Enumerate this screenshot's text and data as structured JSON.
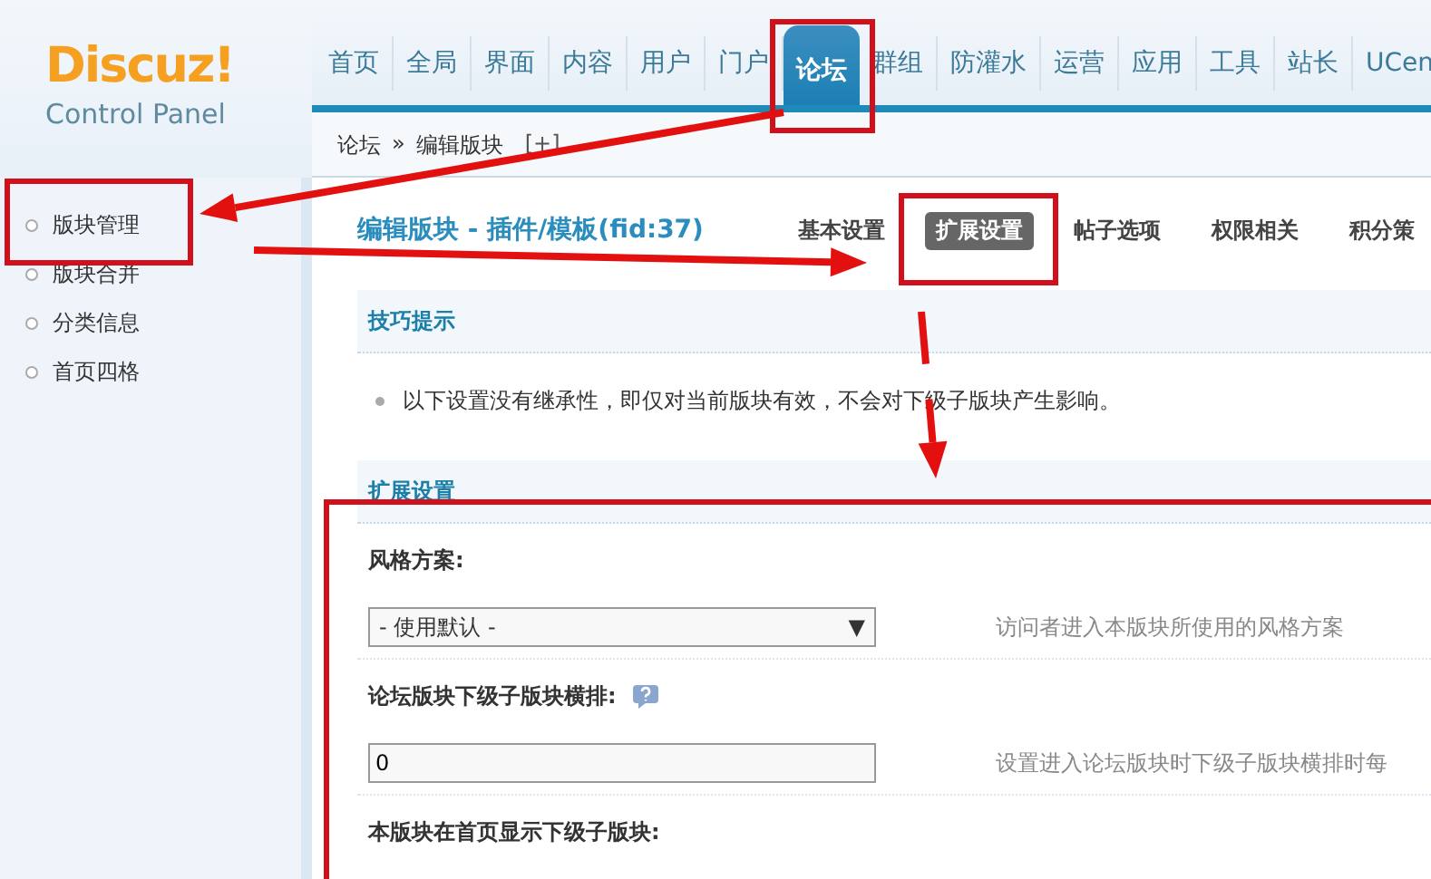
{
  "header": {
    "logo_title": "Discuz!",
    "logo_subtitle": "Control Panel",
    "nav": [
      {
        "label": "首页",
        "selected": false
      },
      {
        "label": "全局",
        "selected": false
      },
      {
        "label": "界面",
        "selected": false
      },
      {
        "label": "内容",
        "selected": false
      },
      {
        "label": "用户",
        "selected": false
      },
      {
        "label": "门户",
        "selected": false
      },
      {
        "label": "论坛",
        "selected": true
      },
      {
        "label": "群组",
        "selected": false
      },
      {
        "label": "防灌水",
        "selected": false
      },
      {
        "label": "运营",
        "selected": false
      },
      {
        "label": "应用",
        "selected": false
      },
      {
        "label": "工具",
        "selected": false
      },
      {
        "label": "站长",
        "selected": false
      },
      {
        "label": "UCen",
        "selected": false
      }
    ]
  },
  "breadcrumb": {
    "items": [
      "论坛",
      "编辑版块"
    ],
    "separator": "»",
    "add": "[+]"
  },
  "sidebar": {
    "items": [
      "版块管理",
      "版块合并",
      "分类信息",
      "首页四格"
    ]
  },
  "main": {
    "title": "编辑版块 - 插件/模板(fid:37)",
    "tabs": [
      {
        "label": "基本设置",
        "selected": false
      },
      {
        "label": "扩展设置",
        "selected": true
      },
      {
        "label": "帖子选项",
        "selected": false
      },
      {
        "label": "权限相关",
        "selected": false
      },
      {
        "label": "积分策",
        "selected": false
      }
    ],
    "tips": {
      "title": "技巧提示",
      "items": [
        "以下设置没有继承性，即仅对当前版块有效，不会对下级子版块产生影响。"
      ]
    },
    "section": {
      "title": "扩展设置",
      "fields": [
        {
          "kind": "select",
          "label": "风格方案:",
          "value": "- 使用默认 -",
          "arrow": "▼",
          "hint": "访问者进入本版块所使用的风格方案",
          "help": false
        },
        {
          "kind": "text",
          "label": "论坛版块下级子版块横排:",
          "value": "0",
          "hint": "设置进入论坛版块时下级子版块横排时每",
          "help": true
        },
        {
          "kind": "heading",
          "label": "本版块在首页显示下级子版块:",
          "help": false
        }
      ]
    }
  }
}
